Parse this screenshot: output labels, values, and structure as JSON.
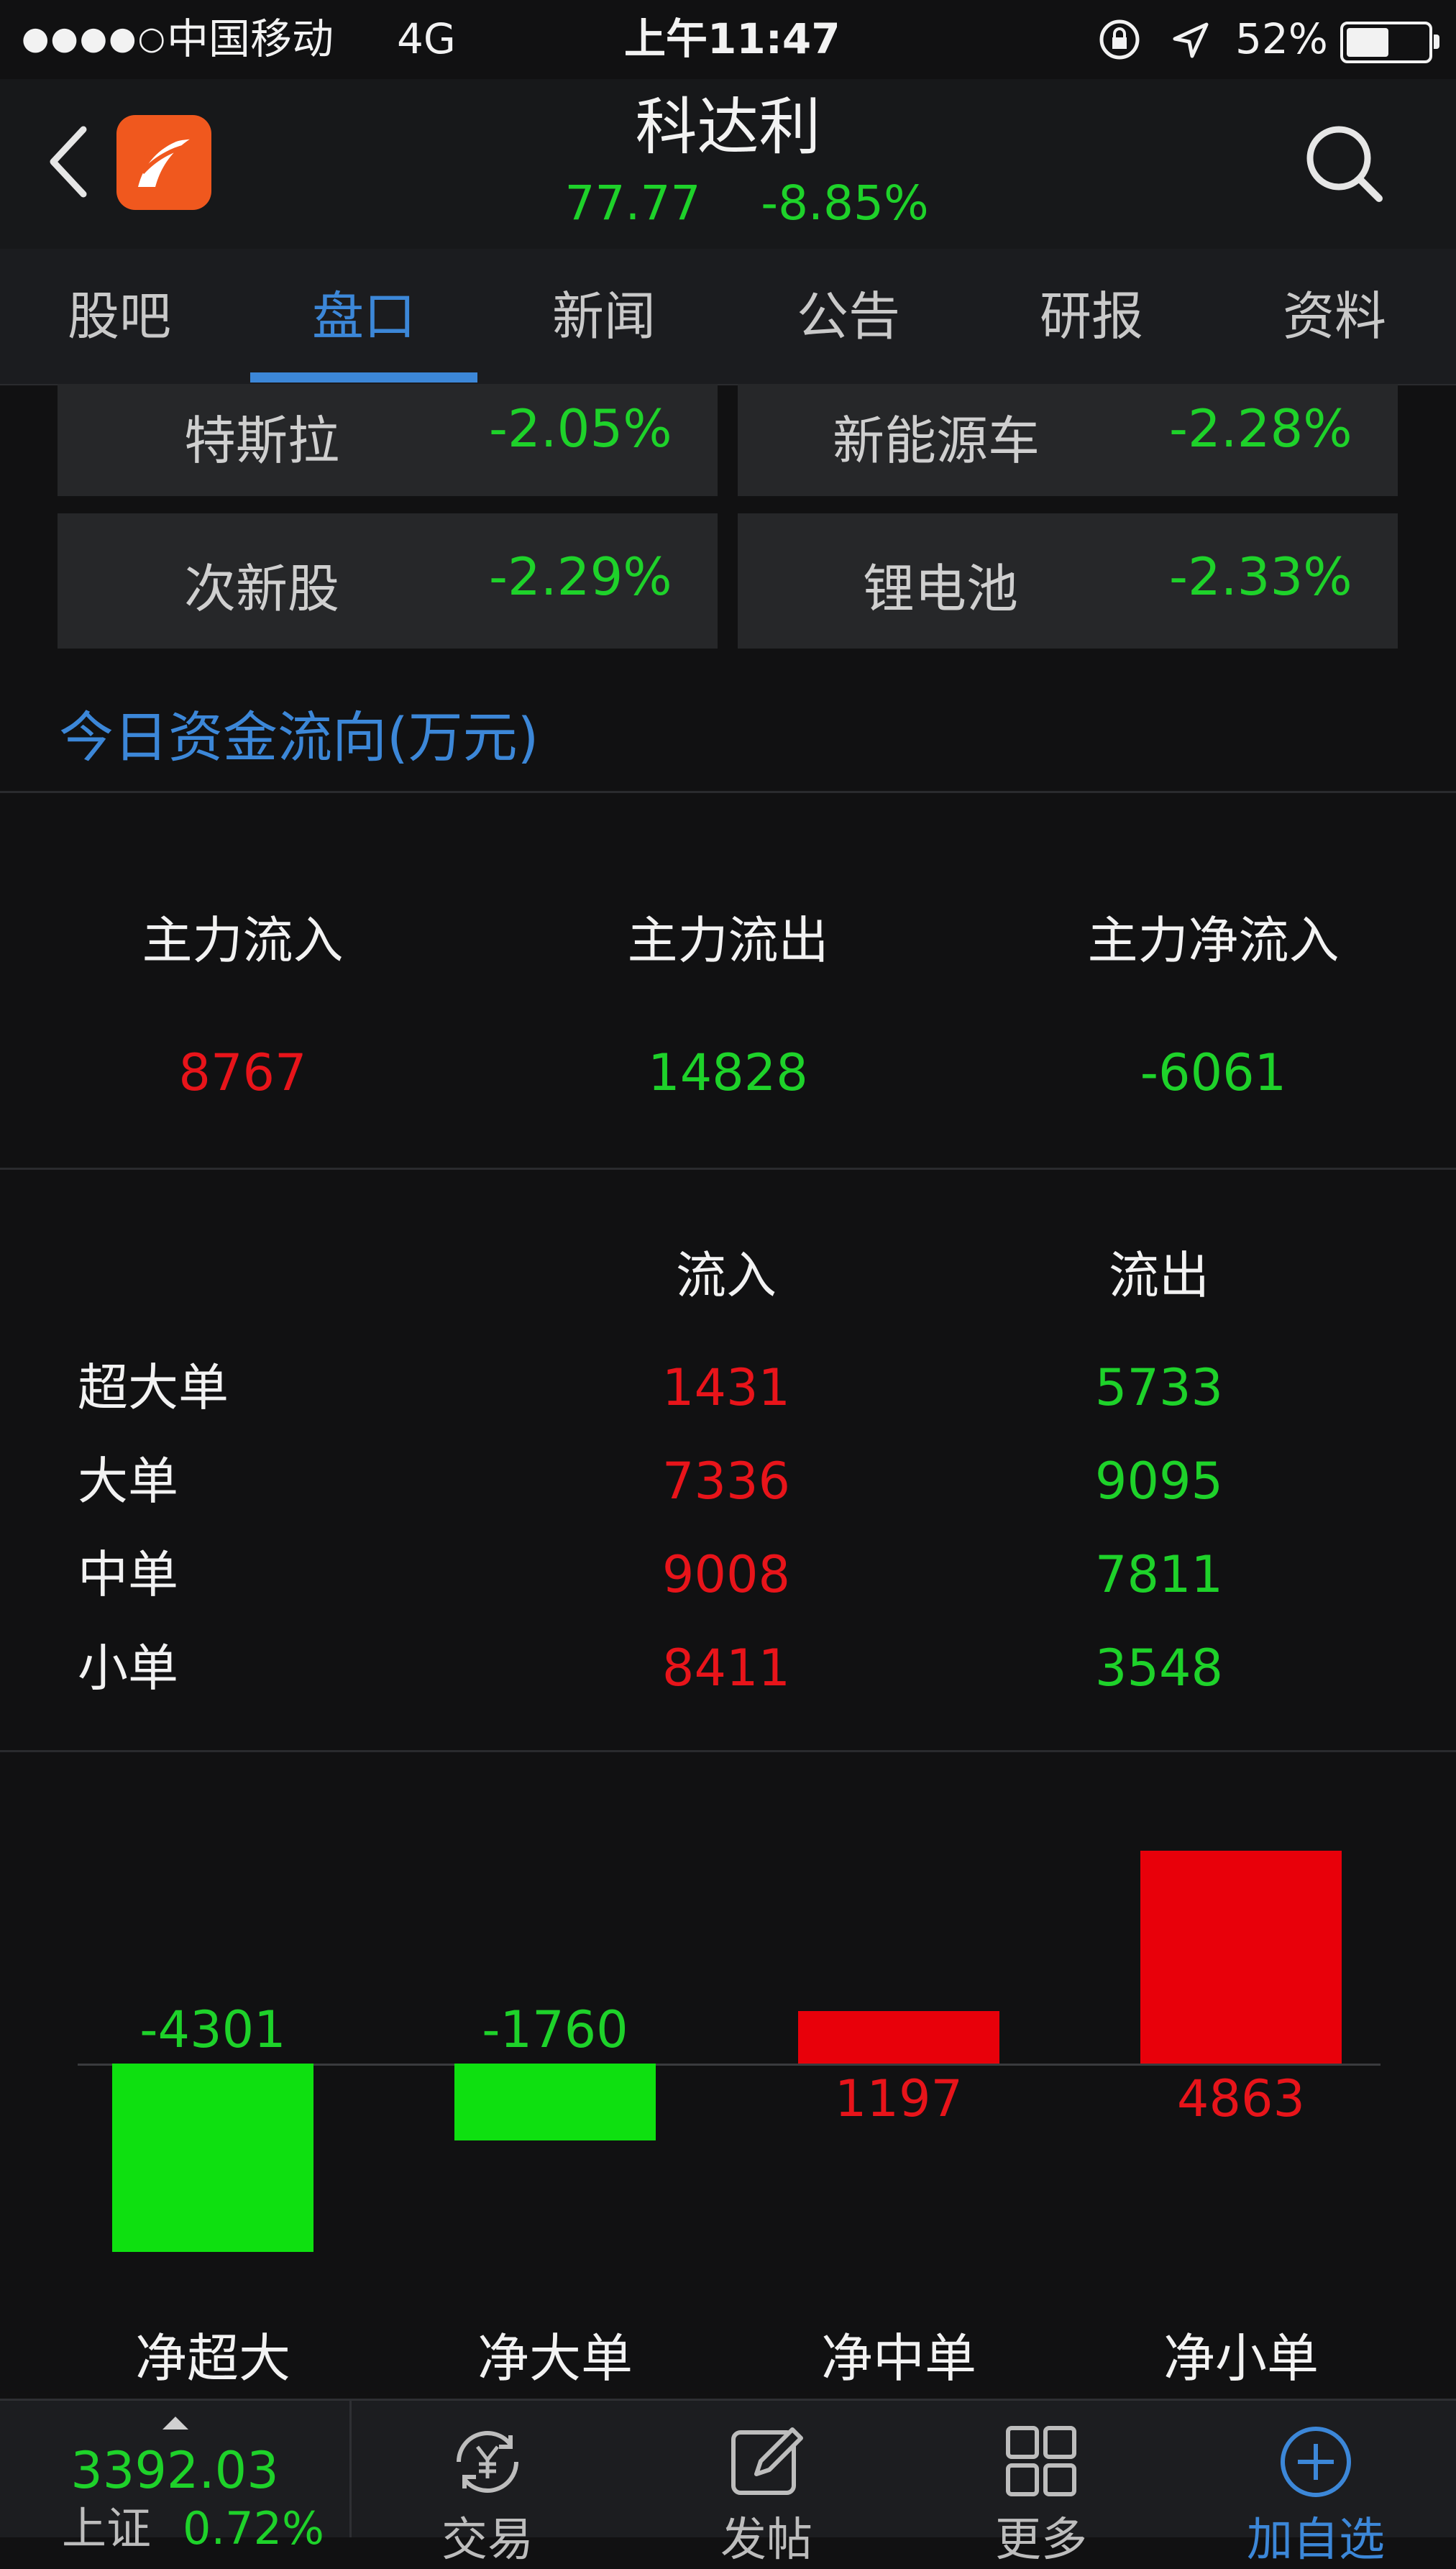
{
  "status_bar": {
    "signal": "●●●●○",
    "carrier": "中国移动",
    "network": "4G",
    "time": "上午11:47",
    "battery": "52%"
  },
  "header": {
    "title": "科达利",
    "price": "77.77",
    "change": "-8.85%"
  },
  "tabs": [
    "股吧",
    "盘口",
    "新闻",
    "公告",
    "研报",
    "资料"
  ],
  "active_tab": 1,
  "sectors": [
    {
      "name": "特斯拉",
      "pct": "-2.05%"
    },
    {
      "name": "新能源车",
      "pct": "-2.28%"
    },
    {
      "name": "次新股",
      "pct": "-2.29%"
    },
    {
      "name": "锂电池",
      "pct": "-2.33%"
    }
  ],
  "fund_flow": {
    "title": "今日资金流向(万元)",
    "main_labels": [
      "主力流入",
      "主力流出",
      "主力净流入"
    ],
    "main_values": [
      "8767",
      "14828",
      "-6061"
    ],
    "table_headers": [
      "流入",
      "流出"
    ],
    "rows": [
      {
        "label": "超大单",
        "in": "1431",
        "out": "5733"
      },
      {
        "label": "大单",
        "in": "7336",
        "out": "9095"
      },
      {
        "label": "中单",
        "in": "9008",
        "out": "7811"
      },
      {
        "label": "小单",
        "in": "8411",
        "out": "3548"
      }
    ]
  },
  "chart_data": {
    "type": "bar",
    "categories": [
      "净超大",
      "净大单",
      "净中单",
      "净小单"
    ],
    "values": [
      -4301,
      -1760,
      1197,
      4863
    ],
    "value_labels": [
      "-4301",
      "-1760",
      "1197",
      "4863"
    ],
    "colors": {
      "positive": "#e8000a",
      "negative": "#0ee010"
    }
  },
  "bottom_nav": {
    "index_value": "3392.03",
    "index_name": "上证",
    "index_change": "0.72%",
    "items": [
      {
        "label": "交易",
        "icon": "trade-yen-icon"
      },
      {
        "label": "发帖",
        "icon": "post-edit-icon"
      },
      {
        "label": "更多",
        "icon": "grid-more-icon"
      },
      {
        "label": "加自选",
        "icon": "add-favorite-icon"
      }
    ]
  }
}
